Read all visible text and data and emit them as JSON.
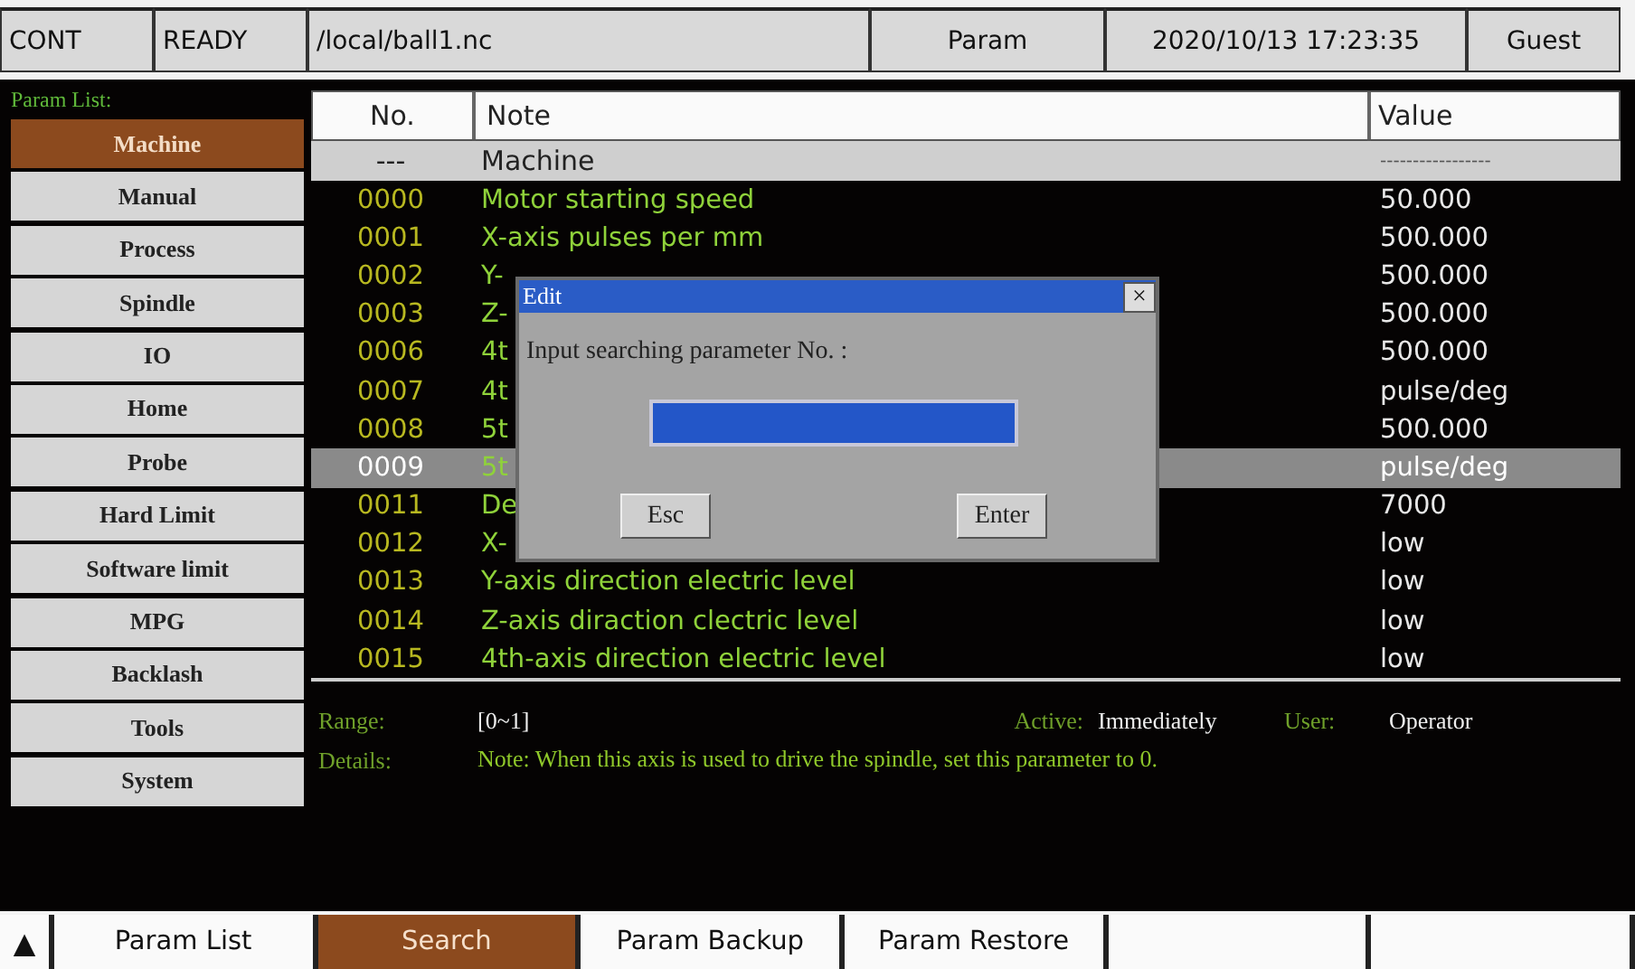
{
  "status_bar": {
    "mode": "CONT",
    "state": "READY",
    "file": "/local/ball1.nc",
    "page": "Param",
    "datetime": "2020/10/13 17:23:35",
    "user": "Guest"
  },
  "sidebar": {
    "title": "Param List:",
    "items": [
      {
        "label": "Machine",
        "selected": true
      },
      {
        "label": "Manual",
        "selected": false
      },
      {
        "label": "Process",
        "selected": false
      },
      {
        "label": "Spindle",
        "selected": false
      },
      {
        "label": "IO",
        "selected": false
      },
      {
        "label": "Home",
        "selected": false
      },
      {
        "label": "Probe",
        "selected": false
      },
      {
        "label": "Hard Limit",
        "selected": false
      },
      {
        "label": "Software limit",
        "selected": false
      },
      {
        "label": "MPG",
        "selected": false
      },
      {
        "label": "Backlash",
        "selected": false
      },
      {
        "label": "Tools",
        "selected": false
      },
      {
        "label": "System",
        "selected": false
      }
    ]
  },
  "table": {
    "columns": [
      "No.",
      "Note",
      "Value"
    ],
    "group": {
      "no": "---",
      "note": "Machine",
      "value": "-----------------"
    },
    "rows": [
      {
        "no": "0000",
        "note": "Motor starting speed",
        "value": "50.000",
        "selected": false
      },
      {
        "no": "0001",
        "note": "X-axis pulses per mm",
        "value": "500.000",
        "selected": false
      },
      {
        "no": "0002",
        "note": "Y-",
        "value": "500.000",
        "selected": false
      },
      {
        "no": "0003",
        "note": "Z-",
        "value": "500.000",
        "selected": false
      },
      {
        "no": "0006",
        "note": "4t",
        "value": "500.000",
        "selected": false
      },
      {
        "no": "0007",
        "note": "4t",
        "value": "pulse/deg",
        "selected": false
      },
      {
        "no": "0008",
        "note": "5t",
        "value": "500.000",
        "selected": false
      },
      {
        "no": "0009",
        "note": "5t",
        "value": "pulse/deg",
        "selected": true
      },
      {
        "no": "0011",
        "note": "De",
        "value": "7000",
        "selected": false
      },
      {
        "no": "0012",
        "note": "X-",
        "value": "low",
        "selected": false
      },
      {
        "no": "0013",
        "note": "Y-axis direction electric level",
        "value": "low",
        "selected": false
      },
      {
        "no": "0014",
        "note": "Z-axis diraction clectric level",
        "value": "low",
        "selected": false
      },
      {
        "no": "0015",
        "note": "4th-axis direction electric level",
        "value": "low",
        "selected": false
      }
    ]
  },
  "details": {
    "range_label": "Range:",
    "range": "[0~1]",
    "active_label": "Active:",
    "active": "Immediately",
    "user_label": "User:",
    "user": "Operator",
    "details_label": "Details:",
    "details": "Note: When this axis is used to drive the spindle, set this parameter to 0."
  },
  "dialog": {
    "title": "Edit",
    "close": "×",
    "prompt": "Input searching parameter No. :",
    "buttons": [
      "Esc",
      "Enter"
    ]
  },
  "bottom_bar": {
    "up": "▲",
    "buttons": [
      {
        "label": "Param List",
        "selected": false
      },
      {
        "label": "Search",
        "selected": true
      },
      {
        "label": "Param Backup",
        "selected": false
      },
      {
        "label": "Param Restore",
        "selected": false
      },
      {
        "selected": false
      },
      {
        "selected": false
      }
    ]
  }
}
